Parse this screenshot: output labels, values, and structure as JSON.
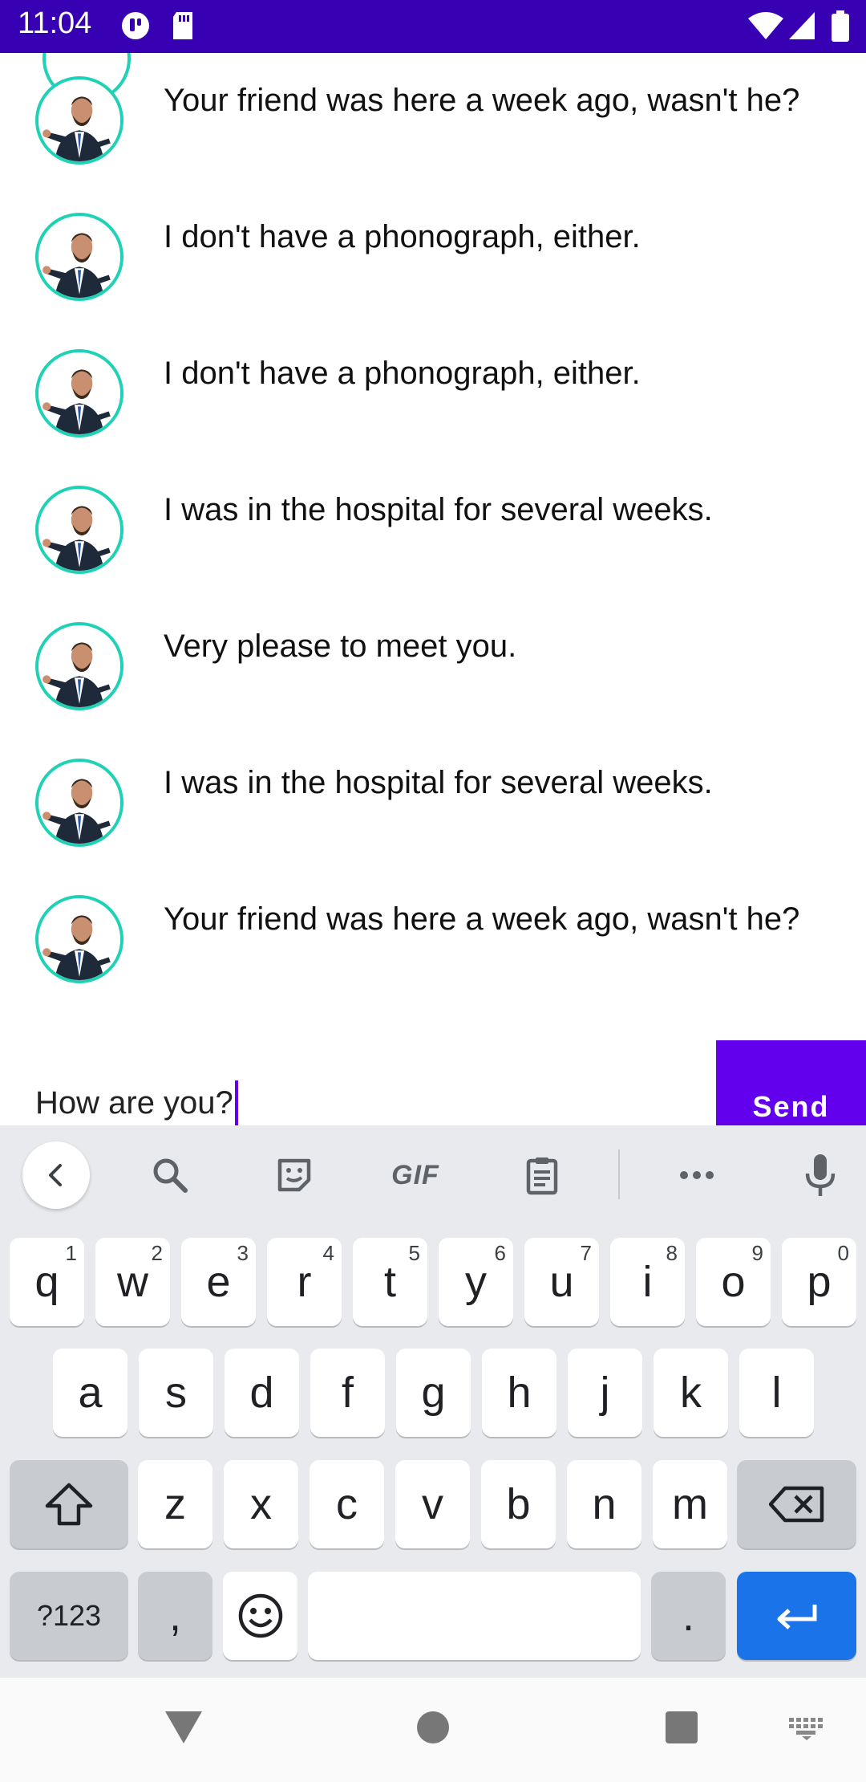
{
  "status_bar": {
    "time": "11:04",
    "icons": [
      "notification-icon",
      "sd-card-icon",
      "wifi-icon",
      "cell-signal-icon",
      "battery-icon"
    ]
  },
  "chat": {
    "messages": [
      {
        "text": "Your friend was here a week ago, wasn't he?"
      },
      {
        "text": "I don't have a phonograph, either."
      },
      {
        "text": "I don't have a phonograph, either."
      },
      {
        "text": "I was in the hospital for several weeks."
      },
      {
        "text": "Very please to meet you."
      },
      {
        "text": "I was in the hospital for several weeks."
      },
      {
        "text": "Your friend was here a week ago, wasn't he?"
      }
    ]
  },
  "composer": {
    "input_value": "How are you?",
    "send_label": "Send"
  },
  "keyboard": {
    "toolbar": {
      "gif_label": "GIF"
    },
    "row1": [
      {
        "key": "q",
        "hint": "1"
      },
      {
        "key": "w",
        "hint": "2"
      },
      {
        "key": "e",
        "hint": "3"
      },
      {
        "key": "r",
        "hint": "4"
      },
      {
        "key": "t",
        "hint": "5"
      },
      {
        "key": "y",
        "hint": "6"
      },
      {
        "key": "u",
        "hint": "7"
      },
      {
        "key": "i",
        "hint": "8"
      },
      {
        "key": "o",
        "hint": "9"
      },
      {
        "key": "p",
        "hint": "0"
      }
    ],
    "row2": [
      "a",
      "s",
      "d",
      "f",
      "g",
      "h",
      "j",
      "k",
      "l"
    ],
    "row3": [
      "z",
      "x",
      "c",
      "v",
      "b",
      "n",
      "m"
    ],
    "symbols_label": "?123",
    "comma_label": ",",
    "period_label": "."
  },
  "colors": {
    "status_bar": "#3700b3",
    "accent": "#6200ee",
    "avatar_ring": "#1fd1b5",
    "enter_key": "#1a73e8"
  }
}
